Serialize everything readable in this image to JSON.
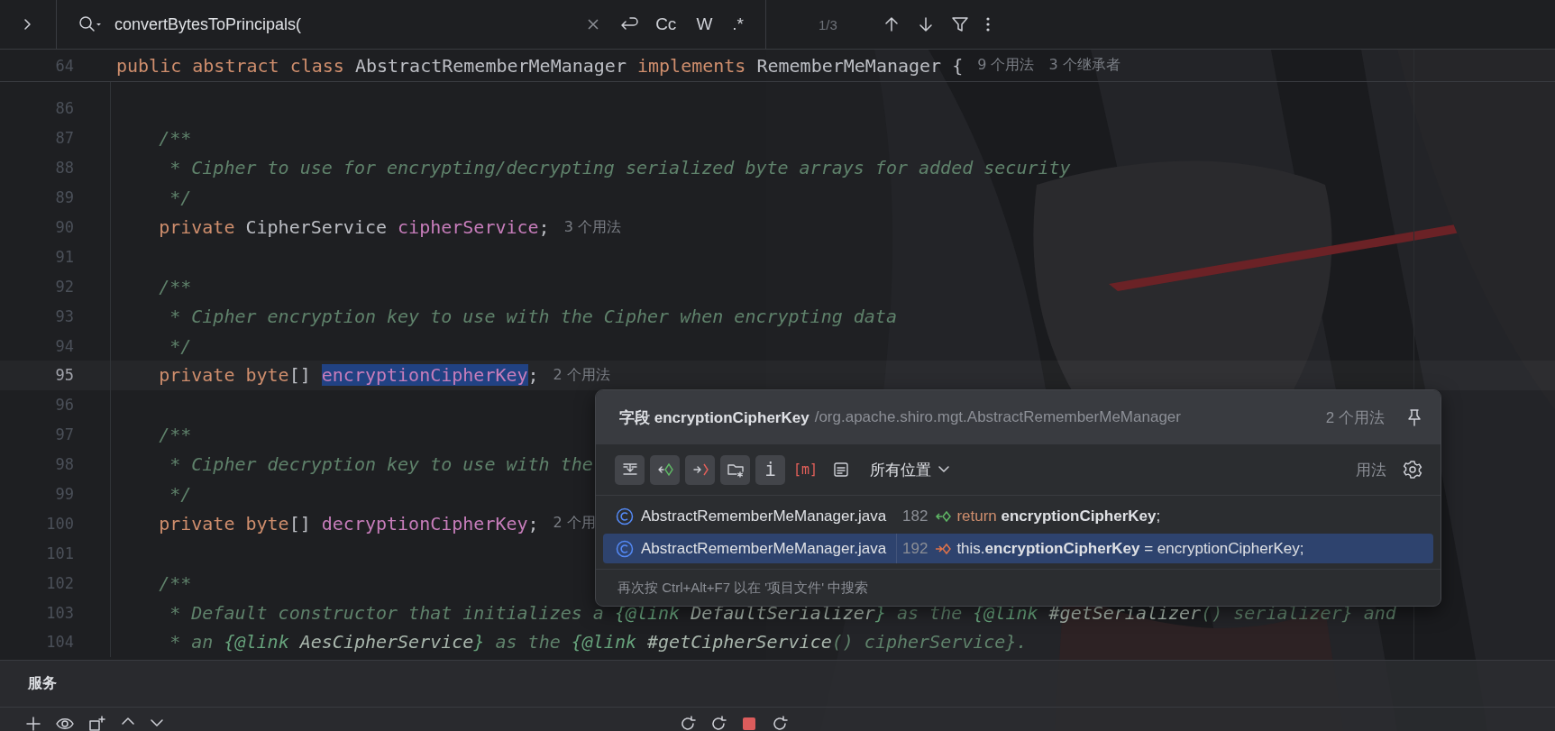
{
  "search": {
    "value": "convertBytesToPrincipals(",
    "options": [
      {
        "label": "Cc",
        "on": false
      },
      {
        "label": "W",
        "on": false
      },
      {
        "label": ".*",
        "on": false
      }
    ],
    "count": "1/3"
  },
  "editor": {
    "sticky_line": {
      "number": "64",
      "tokens": [
        {
          "kind": "kw",
          "text": "public abstract class "
        },
        {
          "kind": "plain",
          "text": "AbstractRememberMeManager "
        },
        {
          "kind": "kw",
          "text": "implements "
        },
        {
          "kind": "plain",
          "text": "RememberMeManager {"
        }
      ],
      "hints": [
        "9 个用法",
        "3 个继承者"
      ]
    },
    "lines": [
      {
        "number": "86",
        "current": false
      },
      {
        "number": "87",
        "current": false,
        "tokens": [
          {
            "kind": "comment",
            "text": "    /**"
          }
        ]
      },
      {
        "number": "88",
        "current": false,
        "tokens": [
          {
            "kind": "comment",
            "text": "     * Cipher to use for encrypting/decrypting serialized byte arrays for added security"
          }
        ]
      },
      {
        "number": "89",
        "current": false,
        "tokens": [
          {
            "kind": "comment",
            "text": "     */"
          }
        ]
      },
      {
        "number": "90",
        "current": false,
        "tokens": [
          {
            "kind": "kw",
            "text": "    private "
          },
          {
            "kind": "plain",
            "text": "CipherService "
          },
          {
            "kind": "field",
            "text": "cipherService",
            "selected": false
          },
          {
            "kind": "plain",
            "text": ";"
          }
        ],
        "hints": [
          "3 个用法"
        ]
      },
      {
        "number": "91",
        "current": false
      },
      {
        "number": "92",
        "current": false,
        "tokens": [
          {
            "kind": "comment",
            "text": "    /**"
          }
        ]
      },
      {
        "number": "93",
        "current": false,
        "tokens": [
          {
            "kind": "comment",
            "text": "     * Cipher encryption key to use with the Cipher when encrypting data"
          }
        ]
      },
      {
        "number": "94",
        "current": false,
        "tokens": [
          {
            "kind": "comment",
            "text": "     */"
          }
        ]
      },
      {
        "number": "95",
        "current": true,
        "tokens": [
          {
            "kind": "kw",
            "text": "    private byte"
          },
          {
            "kind": "plain",
            "text": "[] "
          },
          {
            "kind": "field",
            "text": "encryptionCipherKey",
            "selected": true
          },
          {
            "kind": "plain",
            "text": ";"
          }
        ],
        "hints": [
          "2 个用法"
        ]
      },
      {
        "number": "96",
        "current": false
      },
      {
        "number": "97",
        "current": false,
        "tokens": [
          {
            "kind": "comment",
            "text": "    /**"
          }
        ]
      },
      {
        "number": "98",
        "current": false,
        "tokens": [
          {
            "kind": "comment",
            "text": "     * Cipher decryption key to use with the"
          }
        ]
      },
      {
        "number": "99",
        "current": false,
        "tokens": [
          {
            "kind": "comment",
            "text": "     */"
          }
        ]
      },
      {
        "number": "100",
        "current": false,
        "tokens": [
          {
            "kind": "kw",
            "text": "    private byte"
          },
          {
            "kind": "plain",
            "text": "[] "
          },
          {
            "kind": "field",
            "text": "decryptionCipherKey",
            "selected": false
          },
          {
            "kind": "plain",
            "text": ";"
          }
        ],
        "hints": [
          "2 个用"
        ]
      },
      {
        "number": "101",
        "current": false
      },
      {
        "number": "102",
        "current": false,
        "tokens": [
          {
            "kind": "comment",
            "text": "    /**"
          }
        ]
      },
      {
        "number": "103",
        "current": false,
        "tokens": [
          {
            "kind": "comment",
            "text": "     * Default constructor that initializes a "
          },
          {
            "kind": "tag",
            "text": "{@link"
          },
          {
            "kind": "ref",
            "text": " DefaultSerializer"
          },
          {
            "kind": "tag",
            "text": "}"
          },
          {
            "kind": "comment",
            "text": " as the "
          },
          {
            "kind": "tag",
            "text": "{@link"
          },
          {
            "kind": "ref",
            "text": " #getSerializer"
          },
          {
            "kind": "comment",
            "text": "() serializer}"
          },
          {
            "kind": "comment",
            "text": " and"
          }
        ]
      },
      {
        "number": "104",
        "current": false,
        "tokens": [
          {
            "kind": "comment",
            "text": "     * an "
          },
          {
            "kind": "tag",
            "text": "{@link"
          },
          {
            "kind": "ref",
            "text": " AesCipherService"
          },
          {
            "kind": "tag",
            "text": "}"
          },
          {
            "kind": "comment",
            "text": " as the "
          },
          {
            "kind": "tag",
            "text": "{@link"
          },
          {
            "kind": "ref",
            "text": " #getCipherService"
          },
          {
            "kind": "comment",
            "text": "() cipherService}."
          }
        ]
      }
    ]
  },
  "usages_popup": {
    "title": "字段 encryptionCipherKey",
    "path": "/org.apache.shiro.mgt.AbstractRememberMeManager",
    "count": "2 个用法",
    "toolbar": [
      {
        "kind": "expand",
        "on": true
      },
      {
        "kind": "read",
        "on": true
      },
      {
        "kind": "write",
        "on": true
      },
      {
        "kind": "folder",
        "on": true
      },
      {
        "kind": "text",
        "label": "i",
        "on": true
      },
      {
        "kind": "method",
        "label": "[m]",
        "on": false
      },
      {
        "kind": "preview",
        "on": false
      }
    ],
    "scope": "所有位置",
    "mode_label": "用法",
    "results": [
      {
        "file": "AbstractRememberMeManager.java",
        "line": "182",
        "kind": "read",
        "selected": false,
        "code": [
          {
            "kind": "kw",
            "text": "return "
          },
          {
            "kind": "match",
            "text": "encryptionCipherKey"
          },
          {
            "kind": "plain",
            "text": ";"
          }
        ]
      },
      {
        "file": "AbstractRememberMeManager.java",
        "line": "192",
        "kind": "write",
        "selected": true,
        "code": [
          {
            "kind": "plain",
            "text": "this."
          },
          {
            "kind": "match",
            "text": "encryptionCipherKey"
          },
          {
            "kind": "plain",
            "text": " = encryptionCipherKey;"
          }
        ]
      }
    ],
    "footer": "再次按 Ctrl+Alt+F7 以在 '项目文件' 中搜索"
  },
  "services_panel": {
    "title": "服务"
  }
}
